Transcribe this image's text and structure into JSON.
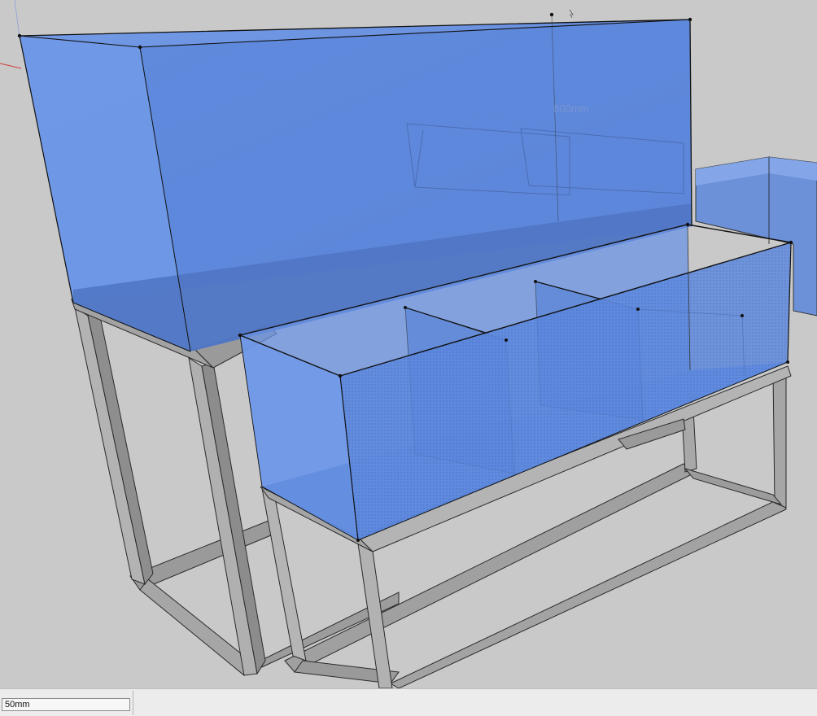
{
  "app": {
    "type": "3D modeling viewport"
  },
  "viewport": {
    "dimension_overlay_text": "800mm",
    "background_color": "#c9c9c9",
    "glass_color": "#4f7fd9",
    "frame_color": "#a8a8a8",
    "axis_red": "#d23a3a"
  },
  "status_bar": {
    "measurement_value": "50mm"
  }
}
